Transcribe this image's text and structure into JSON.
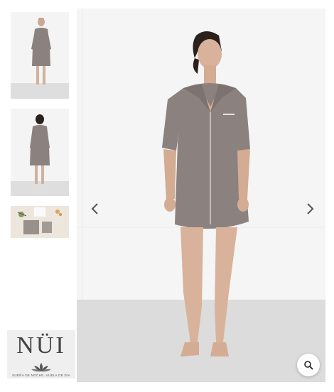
{
  "gallery": {
    "thumbnails": [
      {
        "icon": "product-front-thumbnail"
      },
      {
        "icon": "product-back-thumbnail"
      },
      {
        "icon": "product-packaging-thumbnail"
      }
    ],
    "main_image": {
      "icon": "product-main-photo"
    },
    "prev_icon": "chevron-left-icon",
    "next_icon": "chevron-right-icon",
    "zoom_icon": "magnifier-icon"
  },
  "brand": {
    "name": "NÜI",
    "tagline": "SUEÑA DE NOCHE, VUELA DE DÍA"
  },
  "colors": {
    "background": "#ffffff",
    "garment": "#8b817e",
    "floor": "#dcdcdc",
    "arrow": "#555555"
  }
}
